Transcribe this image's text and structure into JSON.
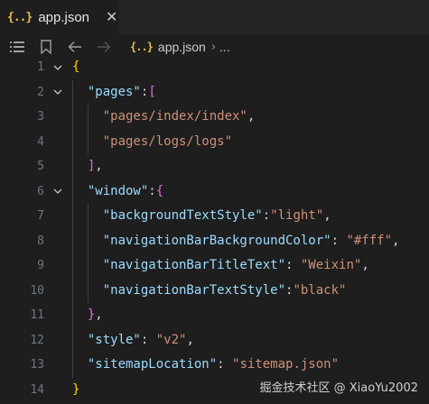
{
  "tab": {
    "icon_glyph": "{..}",
    "label": "app.json",
    "close_glyph": "✕"
  },
  "breadcrumb": {
    "file_icon_glyph": "{..}",
    "file": "app.json",
    "separator": "›",
    "more": "..."
  },
  "toolbar_icons": [
    "list-icon",
    "bookmark-icon",
    "back-arrow-icon",
    "forward-arrow-icon"
  ],
  "editor": {
    "lines": [
      {
        "n": "1",
        "fold": true,
        "tokens": [
          {
            "t": "{",
            "c": "b1"
          }
        ]
      },
      {
        "n": "2",
        "fold": true,
        "tokens": [
          {
            "t": "  "
          },
          {
            "t": "\"pages\"",
            "c": "k"
          },
          {
            "t": ":",
            "c": "p"
          },
          {
            "t": "[",
            "c": "b2"
          }
        ]
      },
      {
        "n": "3",
        "fold": false,
        "tokens": [
          {
            "t": "    "
          },
          {
            "t": "\"pages/index/index\"",
            "c": "s"
          },
          {
            "t": ",",
            "c": "p"
          }
        ]
      },
      {
        "n": "4",
        "fold": false,
        "tokens": [
          {
            "t": "    "
          },
          {
            "t": "\"pages/logs/logs\"",
            "c": "s"
          }
        ]
      },
      {
        "n": "5",
        "fold": false,
        "tokens": [
          {
            "t": "  "
          },
          {
            "t": "]",
            "c": "b2"
          },
          {
            "t": ",",
            "c": "p"
          }
        ]
      },
      {
        "n": "6",
        "fold": true,
        "tokens": [
          {
            "t": "  "
          },
          {
            "t": "\"window\"",
            "c": "k"
          },
          {
            "t": ":",
            "c": "p"
          },
          {
            "t": "{",
            "c": "b2"
          }
        ]
      },
      {
        "n": "7",
        "fold": false,
        "tokens": [
          {
            "t": "    "
          },
          {
            "t": "\"backgroundTextStyle\"",
            "c": "k"
          },
          {
            "t": ":",
            "c": "p"
          },
          {
            "t": "\"light\"",
            "c": "s"
          },
          {
            "t": ",",
            "c": "p"
          }
        ]
      },
      {
        "n": "8",
        "fold": false,
        "tokens": [
          {
            "t": "    "
          },
          {
            "t": "\"navigationBarBackgroundColor\"",
            "c": "k"
          },
          {
            "t": ": ",
            "c": "p"
          },
          {
            "t": "\"#fff\"",
            "c": "s"
          },
          {
            "t": ",",
            "c": "p"
          }
        ]
      },
      {
        "n": "9",
        "fold": false,
        "tokens": [
          {
            "t": "    "
          },
          {
            "t": "\"navigationBarTitleText\"",
            "c": "k"
          },
          {
            "t": ": ",
            "c": "p"
          },
          {
            "t": "\"Weixin\"",
            "c": "s"
          },
          {
            "t": ",",
            "c": "p"
          }
        ]
      },
      {
        "n": "10",
        "fold": false,
        "tokens": [
          {
            "t": "    "
          },
          {
            "t": "\"navigationBarTextStyle\"",
            "c": "k"
          },
          {
            "t": ":",
            "c": "p"
          },
          {
            "t": "\"black\"",
            "c": "s"
          }
        ]
      },
      {
        "n": "11",
        "fold": false,
        "tokens": [
          {
            "t": "  "
          },
          {
            "t": "}",
            "c": "b2"
          },
          {
            "t": ",",
            "c": "p"
          }
        ]
      },
      {
        "n": "12",
        "fold": false,
        "tokens": [
          {
            "t": "  "
          },
          {
            "t": "\"style\"",
            "c": "k"
          },
          {
            "t": ": ",
            "c": "p"
          },
          {
            "t": "\"v2\"",
            "c": "s"
          },
          {
            "t": ",",
            "c": "p"
          }
        ]
      },
      {
        "n": "13",
        "fold": false,
        "tokens": [
          {
            "t": "  "
          },
          {
            "t": "\"sitemapLocation\"",
            "c": "k"
          },
          {
            "t": ": ",
            "c": "p"
          },
          {
            "t": "\"sitemap.json\"",
            "c": "s"
          }
        ]
      },
      {
        "n": "14",
        "fold": false,
        "tokens": [
          {
            "t": "}",
            "c": "b1"
          }
        ]
      }
    ]
  },
  "watermark": "掘金技术社区 @ XiaoYu2002",
  "colors": {
    "background": "#1e1e1e",
    "tabbar": "#252526",
    "key": "#9cdcfe",
    "string": "#ce9178",
    "bracket_level1": "#ffd700",
    "bracket_level2": "#da70d6",
    "line_number": "#6e7681",
    "json_icon": "#e8c04a"
  }
}
